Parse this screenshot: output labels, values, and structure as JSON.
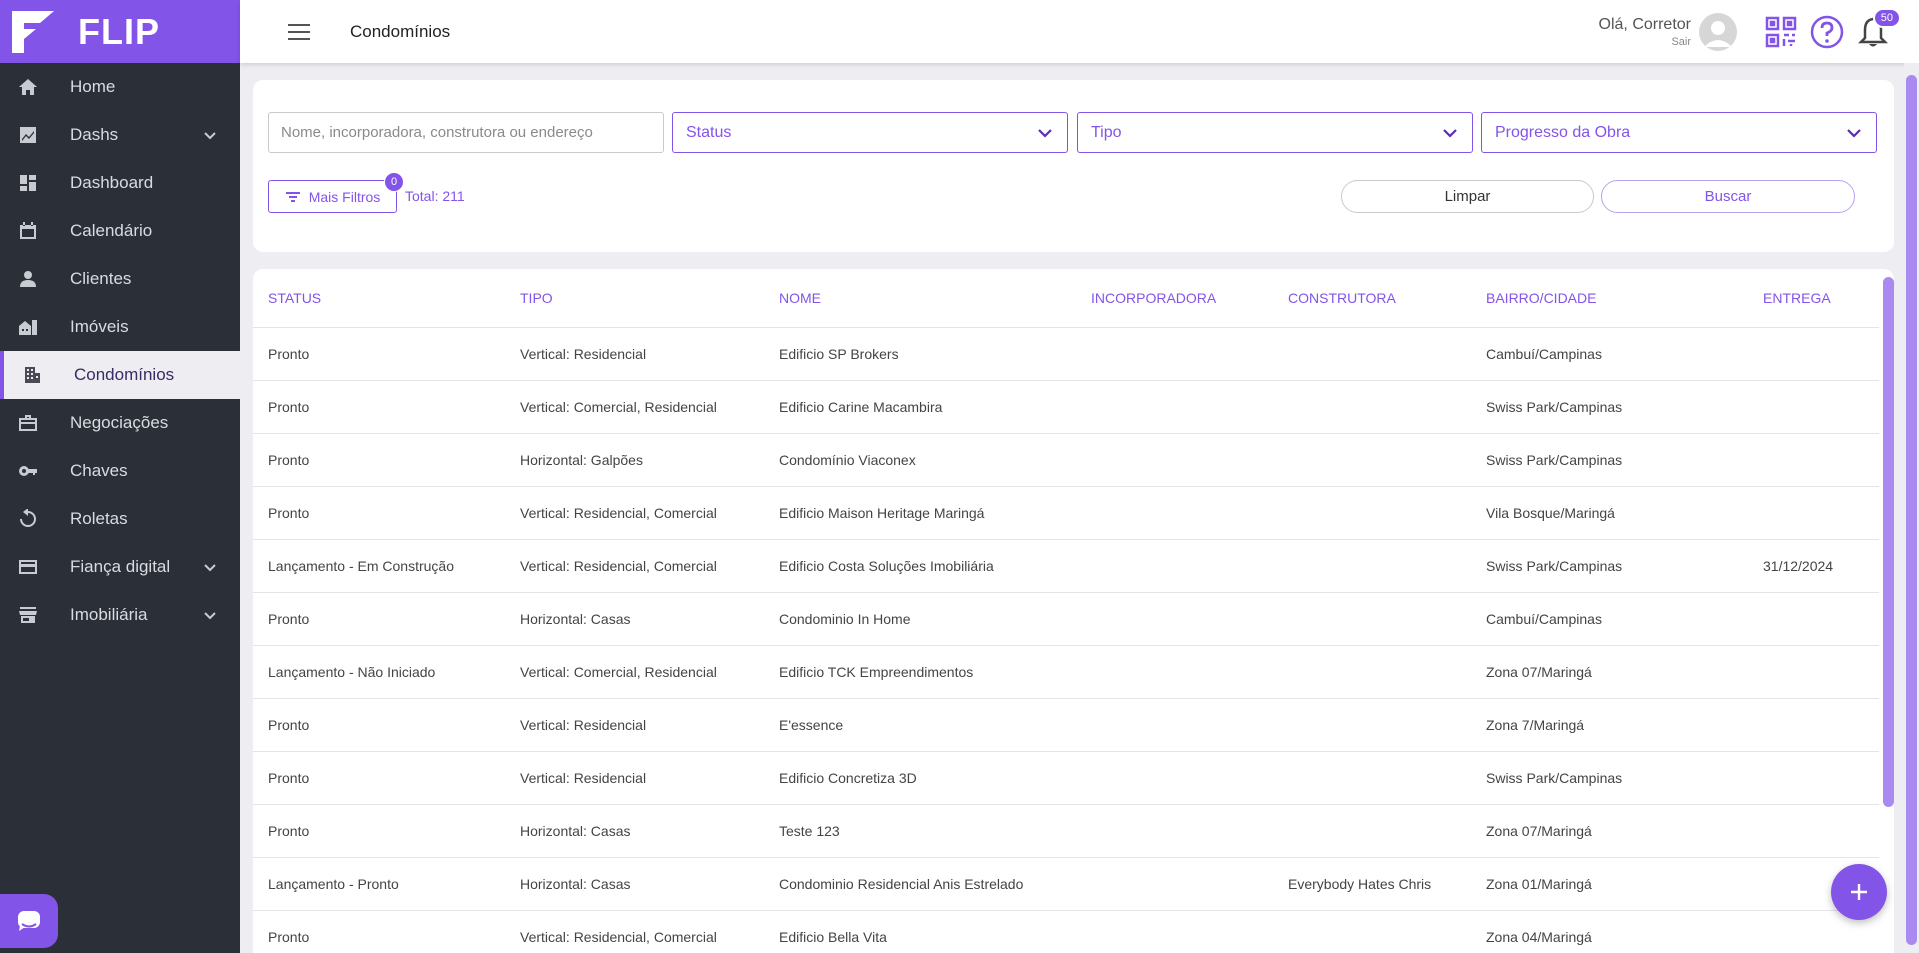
{
  "brand": {
    "name": "FLIP",
    "color": "#8354e8"
  },
  "sidebar": {
    "items": [
      {
        "label": "Home",
        "icon": "home-icon"
      },
      {
        "label": "Dashs",
        "icon": "chart-icon",
        "expandable": true
      },
      {
        "label": "Dashboard",
        "icon": "dashboard-icon"
      },
      {
        "label": "Calendário",
        "icon": "calendar-icon"
      },
      {
        "label": "Clientes",
        "icon": "person-icon"
      },
      {
        "label": "Imóveis",
        "icon": "house-icon"
      },
      {
        "label": "Condomínios",
        "icon": "building-icon",
        "active": true
      },
      {
        "label": "Negociações",
        "icon": "briefcase-icon"
      },
      {
        "label": "Chaves",
        "icon": "key-icon"
      },
      {
        "label": "Roletas",
        "icon": "roulette-icon"
      },
      {
        "label": "Fiança digital",
        "icon": "card-icon",
        "expandable": true
      },
      {
        "label": "Imobiliária",
        "icon": "store-icon",
        "expandable": true
      }
    ]
  },
  "header": {
    "title": "Condomínios",
    "greeting": "Olá, Corretor",
    "logout": "Sair",
    "notifications_count": "50"
  },
  "filters": {
    "search_placeholder": "Nome, incorporadora, construtora ou endereço",
    "status_label": "Status",
    "tipo_label": "Tipo",
    "progresso_label": "Progresso da Obra",
    "mais_filtros_label": "Mais Filtros",
    "mais_filtros_count": "0",
    "total_label": "Total: 211",
    "limpar_label": "Limpar",
    "buscar_label": "Buscar"
  },
  "table": {
    "columns": [
      "STATUS",
      "TIPO",
      "NOME",
      "INCORPORADORA",
      "CONSTRUTORA",
      "BAIRRO/CIDADE",
      "ENTREGA"
    ],
    "rows": [
      [
        "Pronto",
        "Vertical: Residencial",
        "Edificio SP Brokers",
        "",
        "",
        "Cambuí/Campinas",
        ""
      ],
      [
        "Pronto",
        "Vertical: Comercial, Residencial",
        "Edificio Carine Macambira",
        "",
        "",
        "Swiss Park/Campinas",
        ""
      ],
      [
        "Pronto",
        "Horizontal: Galpões",
        "Condomínio Viaconex",
        "",
        "",
        "Swiss Park/Campinas",
        ""
      ],
      [
        "Pronto",
        "Vertical: Residencial, Comercial",
        "Edificio Maison Heritage Maringá",
        "",
        "",
        "Vila Bosque/Maringá",
        ""
      ],
      [
        "Lançamento - Em Construção",
        "Vertical: Residencial, Comercial",
        "Edificio Costa Soluções Imobiliária",
        "",
        "",
        "Swiss Park/Campinas",
        "31/12/2024"
      ],
      [
        "Pronto",
        "Horizontal: Casas",
        "Condominio In Home",
        "",
        "",
        "Cambuí/Campinas",
        ""
      ],
      [
        "Lançamento - Não Iniciado",
        "Vertical: Comercial, Residencial",
        "Edificio TCK Empreendimentos",
        "",
        "",
        "Zona 07/Maringá",
        ""
      ],
      [
        "Pronto",
        "Vertical: Residencial",
        "E'essence",
        "",
        "",
        "Zona 7/Maringá",
        ""
      ],
      [
        "Pronto",
        "Vertical: Residencial",
        "Edificio Concretiza 3D",
        "",
        "",
        "Swiss Park/Campinas",
        ""
      ],
      [
        "Pronto",
        "Horizontal: Casas",
        "Teste 123",
        "",
        "",
        "Zona 07/Maringá",
        ""
      ],
      [
        "Lançamento - Pronto",
        "Horizontal: Casas",
        "Condominio Residencial Anis Estrelado",
        "",
        "Everybody Hates Chris",
        "Zona 01/Maringá",
        ""
      ],
      [
        "Pronto",
        "Vertical: Residencial, Comercial",
        "Edificio Bella Vita",
        "",
        "",
        "Zona 04/Maringá",
        ""
      ]
    ]
  }
}
